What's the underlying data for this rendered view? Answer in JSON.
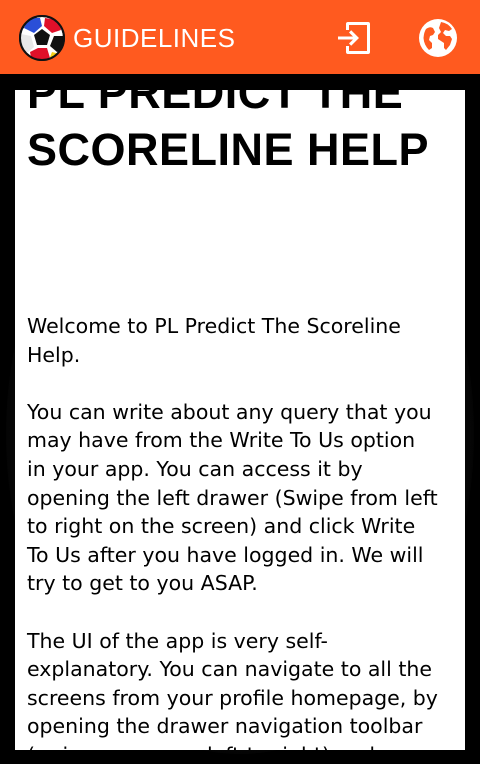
{
  "appbar": {
    "title": "GUIDELINES",
    "logo_icon": "soccer-ball-icon",
    "actions": [
      {
        "name": "logout",
        "icon": "exit-icon"
      },
      {
        "name": "language",
        "icon": "globe-icon"
      }
    ],
    "color": "#ff5a1f"
  },
  "page": {
    "heading": "PL PREDICT THE\nSCORELINE HELP",
    "paragraphs": [
      "Welcome to PL Predict The Scoreline\nHelp.",
      "You can write about any query that you\nmay have from the Write To Us option\nin your app. You can access it by\nopening the left drawer (Swipe from left\nto right on the screen) and click Write\nTo Us after you have logged in. We will\ntry to get to you ASAP.",
      "The UI of the app is very self-\nexplanatory. You can navigate to all the\nscreens from your profile homepage, by\nopening the drawer navigation toolbar\n(swipe on screen left to right) and"
    ]
  }
}
